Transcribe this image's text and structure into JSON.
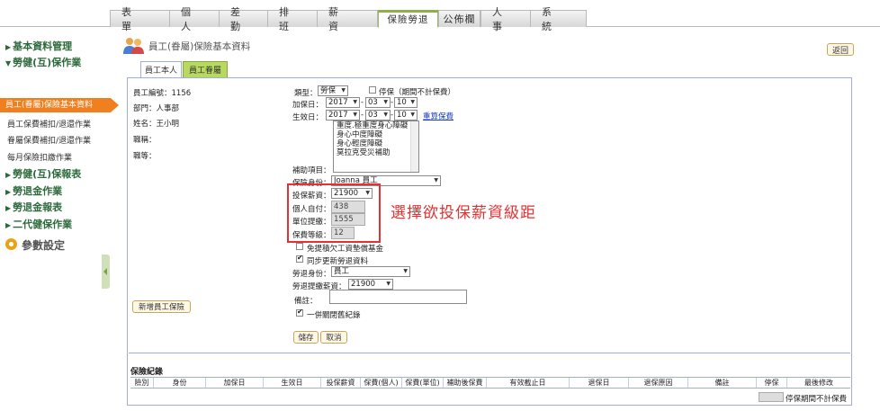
{
  "nav_tabs": [
    "表 單",
    "個 人",
    "差 勤",
    "排 班",
    "薪 資",
    "保險勞退",
    "公佈欄",
    "人 事",
    "系 統"
  ],
  "nav_active_index": 5,
  "sidebar": {
    "h1": "基本資料管理",
    "h2": "勞健(互)保作業",
    "active": "員工(眷屬)保險基本資料",
    "i1": "員工保費補扣/退還作業",
    "i2": "眷屬保費補扣/退還作業",
    "i3": "每月保險扣繳作業",
    "h3": "勞健(互)保報表",
    "h4": "勞退金作業",
    "h5": "勞退金報表",
    "h6": "二代健保作業",
    "param": "參數設定"
  },
  "header": {
    "title": "員工(眷屬)保險基本資料",
    "return_label": "返回"
  },
  "panel_tabs": {
    "self": "員工本人",
    "family": "員工眷屬"
  },
  "employee": {
    "id_label": "員工編號：1156",
    "dept_label": "部門：人事部",
    "name_label": "姓名：王小明",
    "title_label": "職稱：",
    "grade_label": "職等："
  },
  "form": {
    "type_label": "類型：",
    "type_value": "勞保",
    "stop_label": "停保（期間不計保費）",
    "join_label": "加保日：",
    "join_year": "2017",
    "join_month": "03",
    "join_day": "10",
    "date_sep": "-",
    "effect_label": "生效日：",
    "eff_year": "2017",
    "eff_month": "03",
    "eff_day": "10",
    "recalc_label": "重算保費",
    "subsidy_options": [
      "重度.極重度身心障礙",
      "身心中度障礙",
      "身心輕度障礙",
      "莫拉克受災補助"
    ],
    "subsidy_label": "補助項目：",
    "identity_label": "保險身份：",
    "identity_value": "Joanna 員工",
    "salary_label": "投保薪資：",
    "salary_value": "21900",
    "self_pay_label": "個人自付：",
    "self_pay_value": "438",
    "company_label": "單位提繳：",
    "company_value": "1555",
    "grade_label": "保費等級：",
    "grade_value": "12",
    "exempt_label": "免提積欠工資墊償基金",
    "sync_label": "同步更新勞退資料",
    "pension_identity_label": "勞退身份：",
    "pension_identity_value": "員工",
    "pension_salary_label": "勞退提繳薪資：",
    "pension_salary_value": "21900",
    "note_label": "備註：",
    "close_old_label": "一併關閉舊紀錄",
    "save_label": "儲存",
    "cancel_label": "取消",
    "add_label": "新增員工保險"
  },
  "annotation": "選擇欲投保薪資級距",
  "records": {
    "title": "保險紀錄",
    "columns": [
      "險別",
      "身份",
      "加保日",
      "生效日",
      "投保薪資",
      "保費(個人)",
      "保費(單位)",
      "補助後保費",
      "有效截止日",
      "退保日",
      "退保原因",
      "備註",
      "停保",
      "最後修改"
    ],
    "legend": "停保期間不計保費"
  },
  "colors": {
    "accent_orange": "#f07f1f",
    "accent_green": "#8db24a",
    "annotation_red": "#e23232",
    "link_blue": "#1a3ec8"
  }
}
